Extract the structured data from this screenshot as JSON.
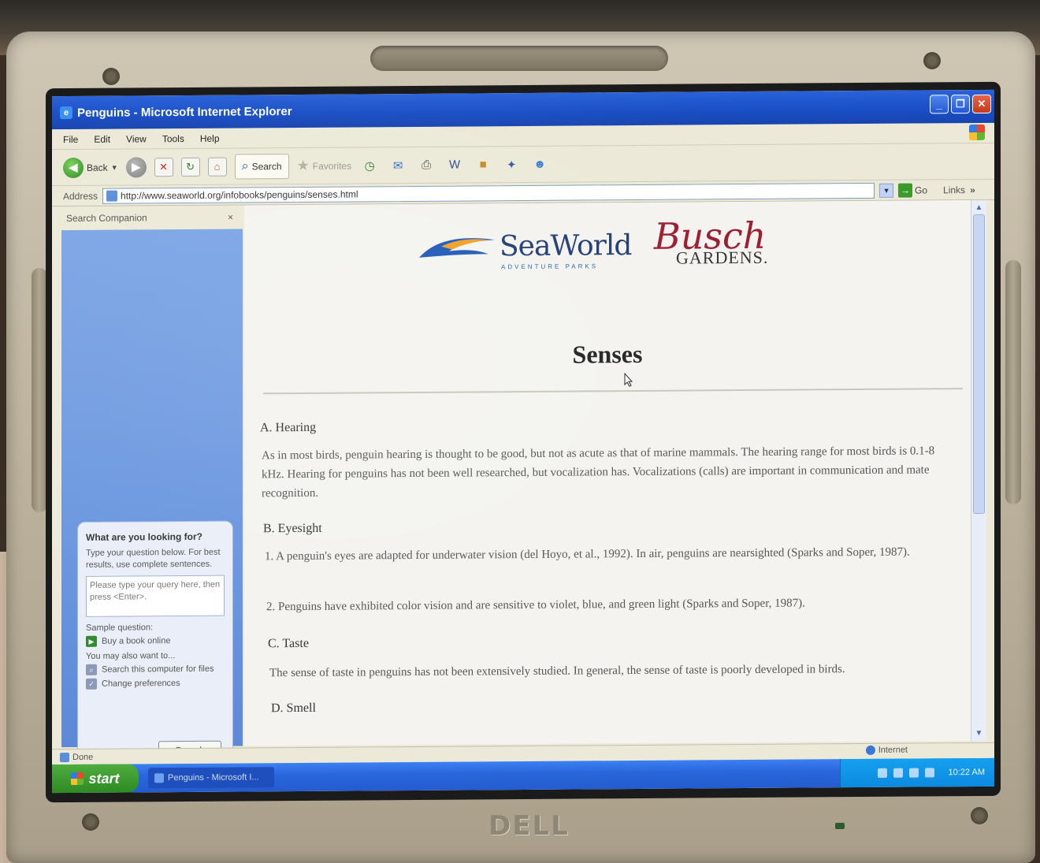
{
  "window": {
    "title": "Penguins - Microsoft Internet Explorer",
    "minimize_icon": "minimize-icon",
    "maximize_icon": "restore-icon",
    "close_icon": "close-icon"
  },
  "menu": [
    "File",
    "Edit",
    "View",
    "Tools",
    "Help"
  ],
  "toolbar": {
    "back_label": "Back",
    "search_label": "Search",
    "favorites_label": "Favorites"
  },
  "address": {
    "label": "Address",
    "url": "http://www.seaworld.org/infobooks/penguins/senses.html",
    "go_label": "Go",
    "links_label": "Links"
  },
  "companion": {
    "header": "Search Companion",
    "close_glyph": "×",
    "question_title": "What are you looking for?",
    "question_hint": "Type your question below. For best results, use complete sentences.",
    "query_placeholder": "Please type your query here, then press <Enter>.",
    "sample_label": "Sample question:",
    "sample_item": "Buy a book online",
    "also_label": "You may also want to...",
    "also_items": [
      "Search this computer for files",
      "Change preferences"
    ],
    "search_button": "Search"
  },
  "page": {
    "logo_seaworld": "SeaWorld",
    "logo_seaworld_sub": "ADVENTURE PARKS",
    "logo_busch": "Busch",
    "logo_gardens": "GARDENS.",
    "heading": "Senses",
    "sections": [
      {
        "title": "A. Hearing"
      },
      {
        "title": "B. Eyesight"
      },
      {
        "title": "C. Taste"
      },
      {
        "title": "D. Smell"
      }
    ],
    "hearing_para": "As in most birds, penguin hearing is thought to be good, but not as acute as that of marine mammals. The hearing range for most birds is 0.1-8 kHz. Hearing for penguins has not been well researched, but vocalization has. Vocalizations (calls) are important in communication and mate recognition.",
    "eyesight_1": "1. A penguin's eyes are adapted for underwater vision (del Hoyo, et al., 1992). In air, penguins are nearsighted (Sparks and Soper, 1987).",
    "eyesight_2": "2. Penguins have exhibited color vision and are sensitive to violet, blue, and green light (Sparks and Soper, 1987).",
    "taste_para": "The sense of taste in penguins has not been extensively studied. In general, the sense of taste is poorly developed in birds."
  },
  "status": {
    "left": "Done",
    "zone": "Internet"
  },
  "taskbar": {
    "start_label": "start",
    "task_item": "Penguins - Microsoft I...",
    "clock": "10:22 AM"
  },
  "hardware": {
    "brand": "DELL"
  }
}
